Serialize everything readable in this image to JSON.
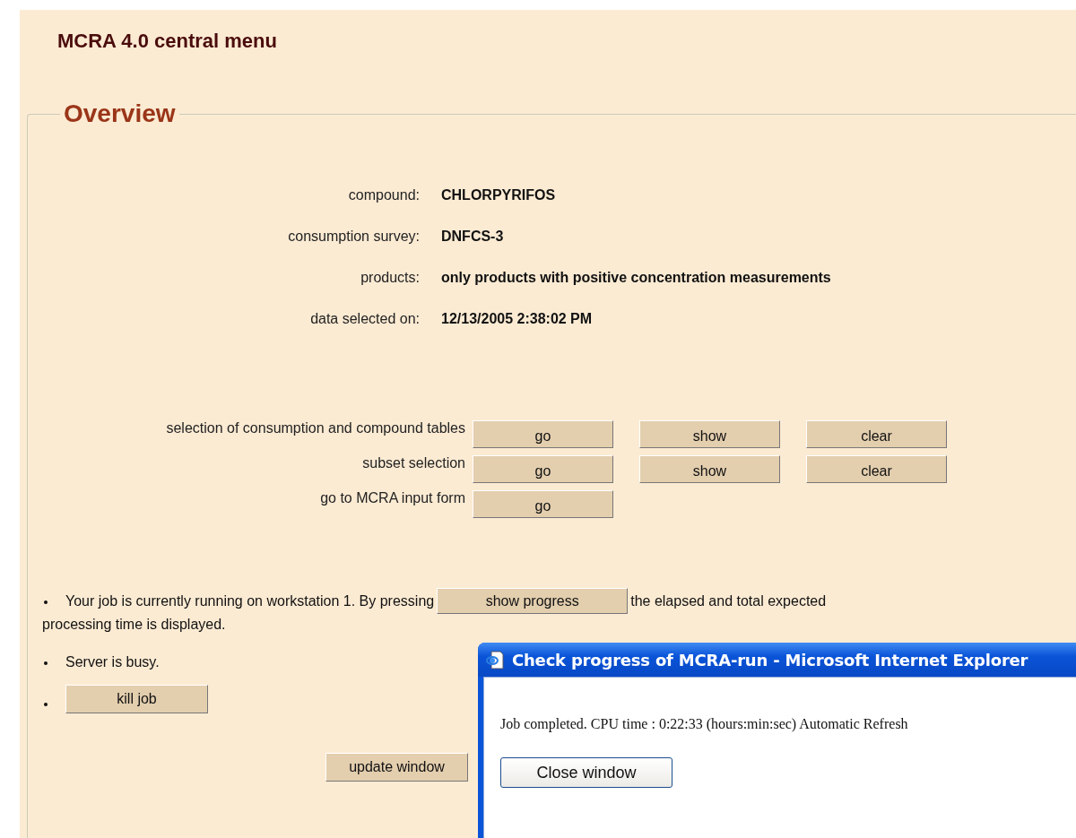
{
  "header": {
    "title": "MCRA 4.0 central menu"
  },
  "overview": {
    "legend": "Overview",
    "fields": [
      {
        "label": "compound:",
        "value": "CHLORPYRIFOS"
      },
      {
        "label": "consumption survey:",
        "value": "DNFCS-3"
      },
      {
        "label": "products:",
        "value": "only products with positive concentration measurements"
      },
      {
        "label": "data selected on:",
        "value": "12/13/2005 2:38:02 PM"
      }
    ],
    "actions": [
      {
        "label": "selection of consumption and compound tables",
        "buttons": [
          "go",
          "show",
          "clear"
        ]
      },
      {
        "label": "subset selection",
        "buttons": [
          "go",
          "show",
          "clear"
        ]
      },
      {
        "label": "go to MCRA input form",
        "buttons": [
          "go"
        ]
      }
    ],
    "status": [
      {
        "kind": "text_with_button",
        "before": "Your job is currently running on workstation 1. By pressing",
        "button": "show progress",
        "after": "the elapsed and total expected",
        "continuation": "processing time is displayed."
      },
      {
        "kind": "text",
        "text": "Server is busy."
      },
      {
        "kind": "button",
        "button": "kill job"
      }
    ],
    "update_button": "update window"
  },
  "popup": {
    "title": "Check progress of MCRA-run - Microsoft Internet Explorer",
    "message": "Job completed. CPU time : 0:22:33 (hours:min:sec) Automatic Refresh",
    "button": "Close window"
  }
}
